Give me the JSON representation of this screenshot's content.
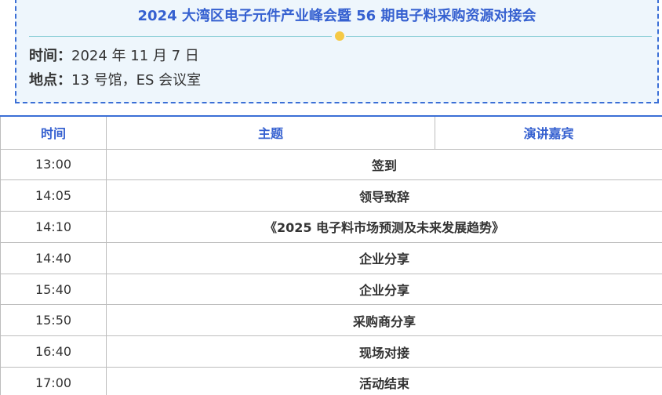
{
  "event": {
    "title": "2024 大湾区电子元件产业峰会暨 56 期电子料采购资源对接会",
    "time_label": "时间：",
    "time_value": "2024 年 11 月 7 日",
    "place_label": "地点：",
    "place_value": "13 号馆，ES 会议室"
  },
  "colors": {
    "accent": "#3560d0",
    "box_background": "#eef6fc",
    "dot": "#f5c945",
    "divider": "#8fd0d8"
  },
  "schedule": {
    "headers": [
      "时间",
      "主题",
      "演讲嘉宾"
    ],
    "rows": [
      {
        "time": "13:00",
        "topic": "签到"
      },
      {
        "time": "14:05",
        "topic": "领导致辞"
      },
      {
        "time": "14:10",
        "topic": "《2025 电子料市场预测及未来发展趋势》"
      },
      {
        "time": "14:40",
        "topic": "企业分享"
      },
      {
        "time": "15:40",
        "topic": "企业分享"
      },
      {
        "time": "15:50",
        "topic": "采购商分享"
      },
      {
        "time": "16:40",
        "topic": "现场对接"
      },
      {
        "time": "17:00",
        "topic": "活动结束"
      }
    ]
  }
}
